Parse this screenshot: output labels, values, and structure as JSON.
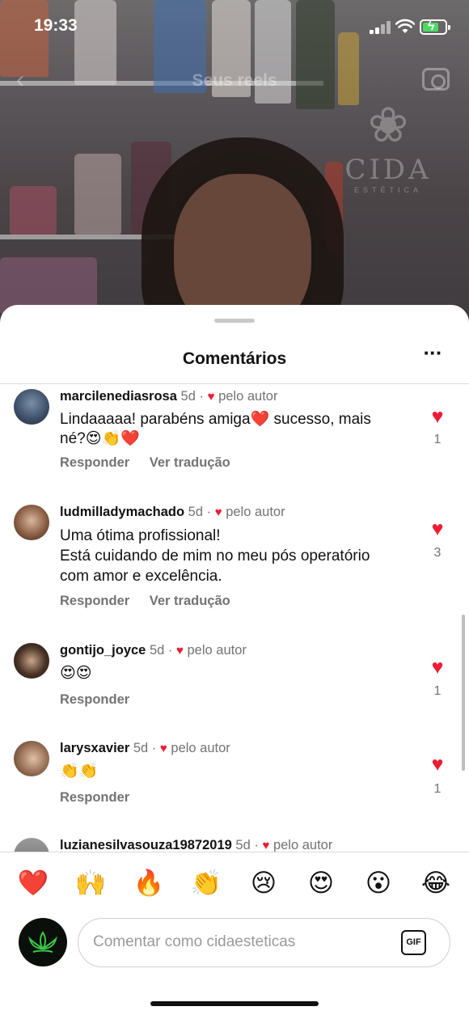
{
  "status_bar": {
    "time": "19:33"
  },
  "video": {
    "title": "Seus reels",
    "watermark": {
      "brand": "CIDA",
      "sub": "ESTÉTICA"
    }
  },
  "sheet": {
    "title": "Comentários"
  },
  "comments": [
    {
      "user": "marcilenediasrosa",
      "age": "5d",
      "author_like": "pelo autor",
      "text": "Lindaaaaa! parabéns amiga❤️ sucesso, mais né?😍👏❤️",
      "actions": [
        "Responder",
        "Ver tradução"
      ],
      "likes": "1"
    },
    {
      "user": "ludmilladymachado",
      "age": "5d",
      "author_like": "pelo autor",
      "text": "Uma ótima profissional!\nEstá cuidando de mim no meu pós operatório com amor e excelência.",
      "actions": [
        "Responder",
        "Ver tradução"
      ],
      "likes": "3"
    },
    {
      "user": "gontijo_joyce",
      "age": "5d",
      "author_like": "pelo autor",
      "text": "😍😍",
      "actions": [
        "Responder"
      ],
      "likes": "1"
    },
    {
      "user": "larysxavier",
      "age": "5d",
      "author_like": "pelo autor",
      "text": "👏👏",
      "actions": [
        "Responder"
      ],
      "likes": "1"
    },
    {
      "user": "luzianesilvasouza19872019",
      "age": "5d",
      "author_like": "pelo autor",
      "text": "",
      "actions": [],
      "likes": ""
    }
  ],
  "reactions": [
    "❤️",
    "🙌",
    "🔥",
    "👏",
    "😢",
    "😍",
    "😮",
    "😂"
  ],
  "composer": {
    "placeholder": "Comentar como cidaesteticas",
    "gif_label": "GIF"
  },
  "colors": {
    "like_red": "#ed1c34",
    "secondary_text": "#737373"
  }
}
